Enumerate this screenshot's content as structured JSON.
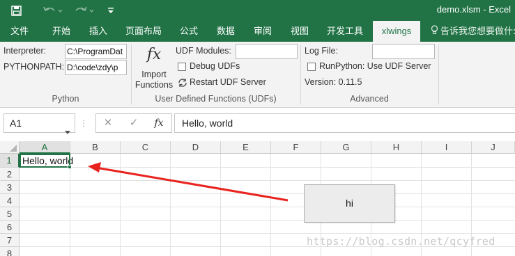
{
  "window": {
    "title": "demo.xlsm  -  Excel"
  },
  "quick_access": {
    "save_icon": "floppy-save-icon",
    "undo_icon": "undo-arrow-icon",
    "redo_icon": "redo-arrow-icon",
    "customize_icon": "customize-toolbar-icon"
  },
  "tabs": [
    {
      "label": "文件"
    },
    {
      "label": "开始"
    },
    {
      "label": "插入"
    },
    {
      "label": "页面布局"
    },
    {
      "label": "公式"
    },
    {
      "label": "数据"
    },
    {
      "label": "审阅"
    },
    {
      "label": "视图"
    },
    {
      "label": "开发工具"
    },
    {
      "label": "xlwings"
    }
  ],
  "tell_me": "告诉我您想要做什么",
  "ribbon": {
    "python": {
      "interpreter_label": "Interpreter:",
      "interpreter_value": "C:\\ProgramDat",
      "pythonpath_label": "PYTHONPATH:",
      "pythonpath_value": "D:\\code\\zdy\\p",
      "group_label": "Python"
    },
    "udfs": {
      "import_icon": "fx",
      "import_label_1": "Import",
      "import_label_2": "Functions",
      "modules_label": "UDF Modules:",
      "modules_value": "",
      "debug_label": "Debug UDFs",
      "restart_label": "Restart UDF Server",
      "group_label": "User Defined Functions (UDFs)"
    },
    "advanced": {
      "logfile_label": "Log File:",
      "logfile_value": "",
      "runpython_label": "RunPython: Use UDF Server",
      "version_label": "Version: 0.11.5",
      "group_label": "Advanced"
    }
  },
  "formula_bar": {
    "name_box": "A1",
    "cancel_glyph": "✕",
    "enter_glyph": "✓",
    "fx_glyph": "fx",
    "formula": "Hello, world"
  },
  "grid": {
    "columns": [
      "A",
      "B",
      "C",
      "D",
      "E",
      "F",
      "G",
      "H",
      "I",
      "J"
    ],
    "rows": [
      "1",
      "2",
      "3",
      "4",
      "5",
      "6",
      "7",
      "8"
    ],
    "cell_A1": "Hello, world"
  },
  "button": {
    "label": "hi"
  },
  "watermark": "https://blog.csdn.net/qcyfred",
  "colors": {
    "excel_green": "#217346",
    "arrow_red": "#e8231e"
  }
}
